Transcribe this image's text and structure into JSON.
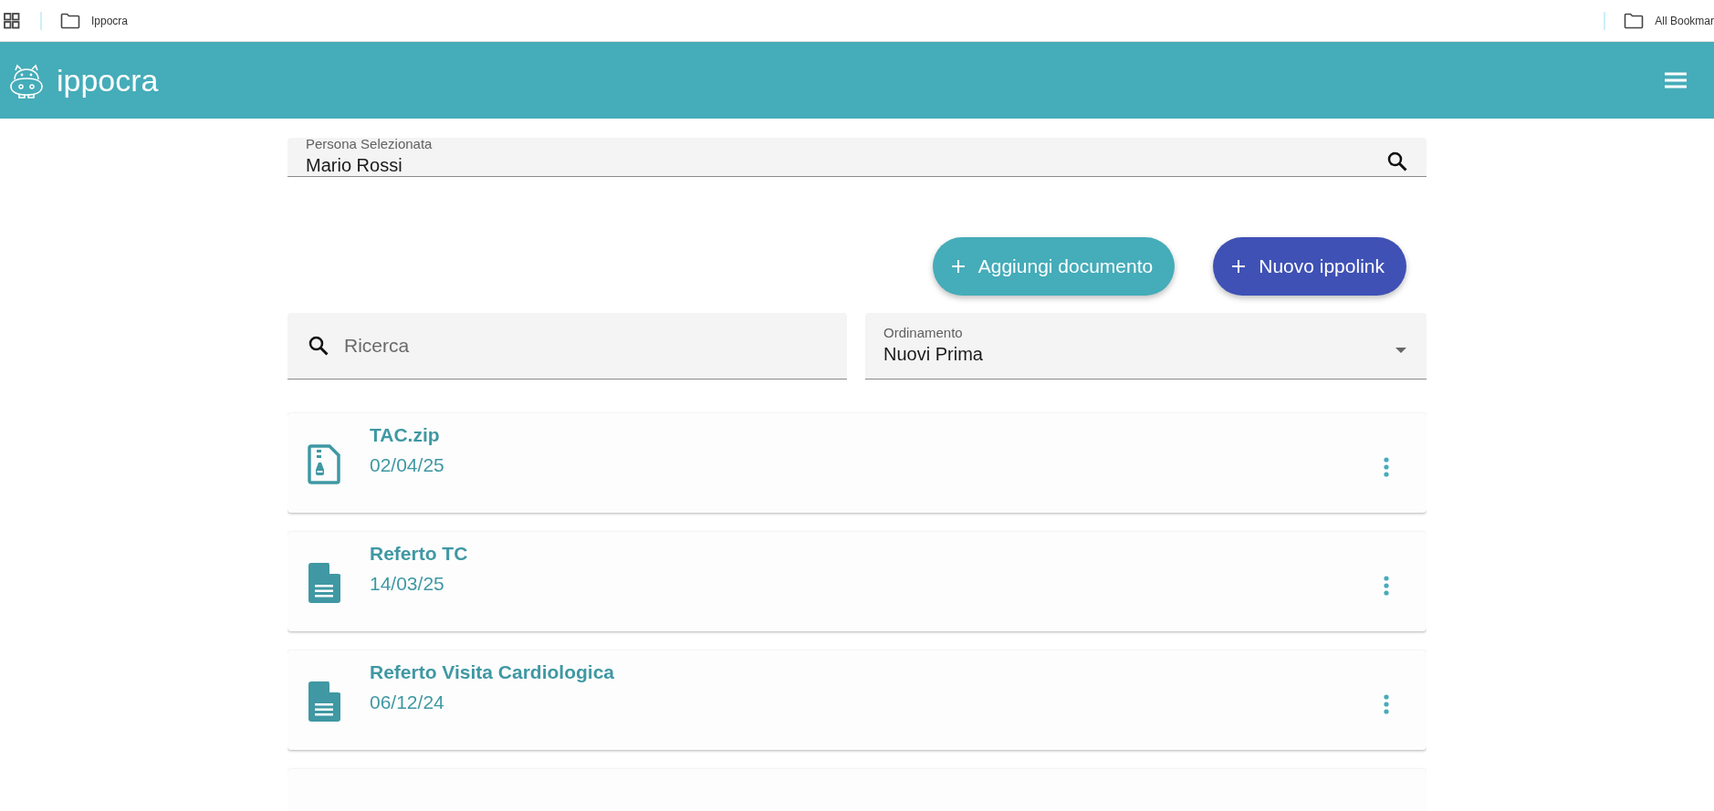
{
  "bookmarks_bar": {
    "items": [
      {
        "label": "Ippocra"
      }
    ],
    "other": {
      "label": "All Bookmar"
    }
  },
  "app_bar": {
    "title": "ippocra"
  },
  "person_field": {
    "label": "Persona Selezionata",
    "value": "Mario Rossi"
  },
  "actions": [
    {
      "label": "Aggiungi documento",
      "kind": "secondary"
    },
    {
      "label": "Nuovo ippolink",
      "kind": "primary"
    }
  ],
  "search": {
    "placeholder": "Ricerca"
  },
  "sort_field": {
    "label": "Ordinamento",
    "value": "Nuovi Prima"
  },
  "documents": [
    {
      "title": "TAC.zip",
      "date": "02/04/25",
      "kind": "zip"
    },
    {
      "title": "Referto TC",
      "date": "14/03/25",
      "kind": "document"
    },
    {
      "title": "Referto Visita Cardiologica",
      "date": "06/12/24",
      "kind": "document"
    }
  ]
}
